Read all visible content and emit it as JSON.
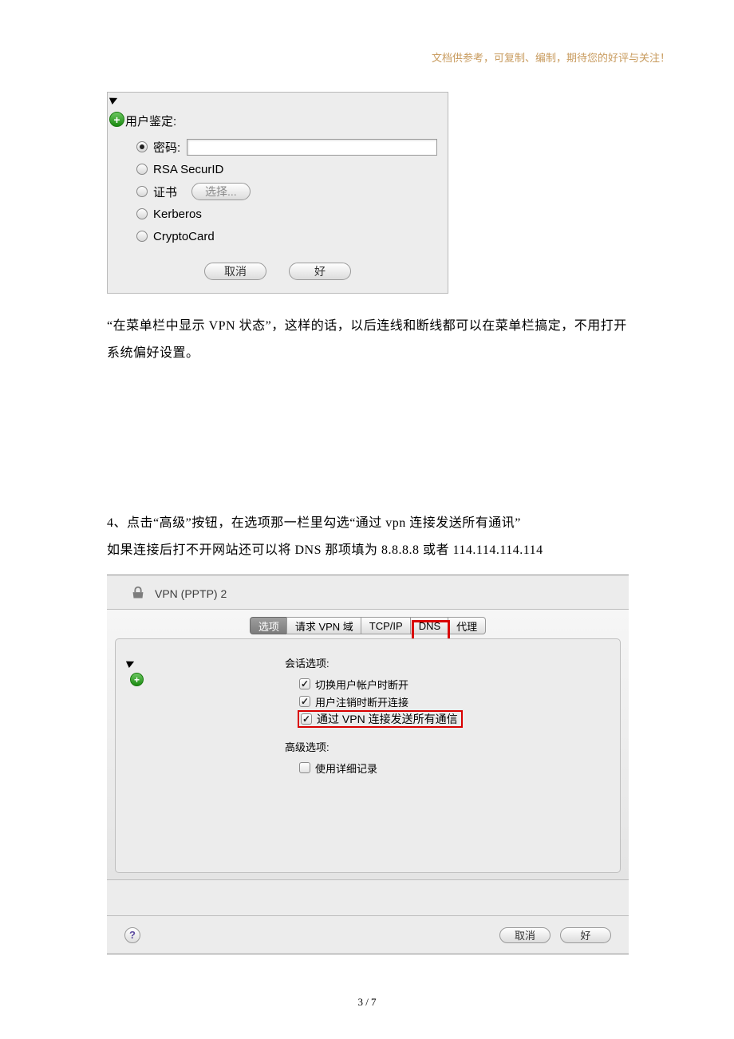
{
  "header_note": "文档供参考，可复制、编制，期待您的好评与关注！",
  "dialog1": {
    "title": "用户鉴定:",
    "radios": {
      "password": "密码:",
      "rsa": "RSA SecurID",
      "cert": "证书",
      "cert_btn": "选择...",
      "kerberos": "Kerberos",
      "crypto": "CryptoCard"
    },
    "cancel": "取消",
    "ok": "好"
  },
  "para1": "“在菜单栏中显示 VPN 状态”，这样的话，以后连线和断线都可以在菜单栏搞定，不用打开系统偏好设置。",
  "step4a": "4、点击“高级”按钮，在选项那一栏里勾选“通过 vpn 连接发送所有通讯”",
  "step4b": "如果连接后打不开网站还可以将 DNS 那项填为 8.8.8.8 或者 114.114.114.114",
  "dialog2": {
    "title": "VPN (PPTP) 2",
    "tabs": {
      "options": "选项",
      "vpn_domain": "请求 VPN 域",
      "tcpip": "TCP/IP",
      "dns": "DNS",
      "proxy": "代理"
    },
    "session_title": "会话选项:",
    "chk_switch": "切换用户帐户时断开",
    "chk_logout": "用户注销时断开连接",
    "chk_sendall": "通过 VPN 连接发送所有通信",
    "adv_title": "高级选项:",
    "chk_detail": "使用详细记录",
    "help": "?",
    "cancel": "取消",
    "ok": "好"
  },
  "page_num": "3 / 7"
}
